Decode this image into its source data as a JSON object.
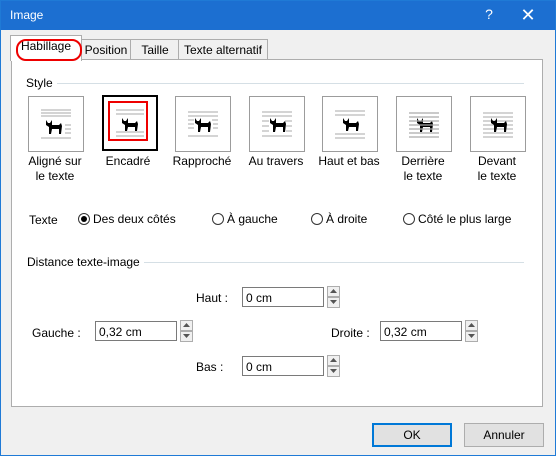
{
  "window": {
    "title": "Image",
    "help_label": "?",
    "close_label": "✕"
  },
  "tabs": [
    {
      "label": "Habillage"
    },
    {
      "label": "Position"
    },
    {
      "label": "Taille"
    },
    {
      "label": "Texte alternatif"
    }
  ],
  "style_group": {
    "label": "Style",
    "options": [
      {
        "line1": "Aligné sur",
        "line2": "le texte",
        "icon": "inline-icon"
      },
      {
        "line1": "Encadré",
        "line2": "",
        "icon": "square-wrap-icon"
      },
      {
        "line1": "Rapproché",
        "line2": "",
        "icon": "tight-wrap-icon"
      },
      {
        "line1": "Au travers",
        "line2": "",
        "icon": "through-wrap-icon"
      },
      {
        "line1": "Haut et bas",
        "line2": "",
        "icon": "top-bottom-wrap-icon"
      },
      {
        "line1": "Derrière",
        "line2": "le texte",
        "icon": "behind-text-icon"
      },
      {
        "line1": "Devant",
        "line2": "le texte",
        "icon": "in-front-text-icon"
      }
    ]
  },
  "text_wrap": {
    "label": "Texte",
    "options": [
      {
        "label": "Des deux côtés"
      },
      {
        "label": "À gauche"
      },
      {
        "label": "À droite"
      },
      {
        "label": "Côté le plus large"
      }
    ]
  },
  "distance": {
    "label": "Distance texte-image",
    "haut_label": "Haut :",
    "haut_value": "0 cm",
    "gauche_label": "Gauche :",
    "gauche_value": "0,32 cm",
    "droite_label": "Droite :",
    "droite_value": "0,32 cm",
    "bas_label": "Bas :",
    "bas_value": "0 cm"
  },
  "buttons": {
    "ok": "OK",
    "cancel": "Annuler"
  },
  "colors": {
    "titlebar": "#1c6fd1",
    "highlight": "#e00000",
    "accent": "#0078d7"
  }
}
